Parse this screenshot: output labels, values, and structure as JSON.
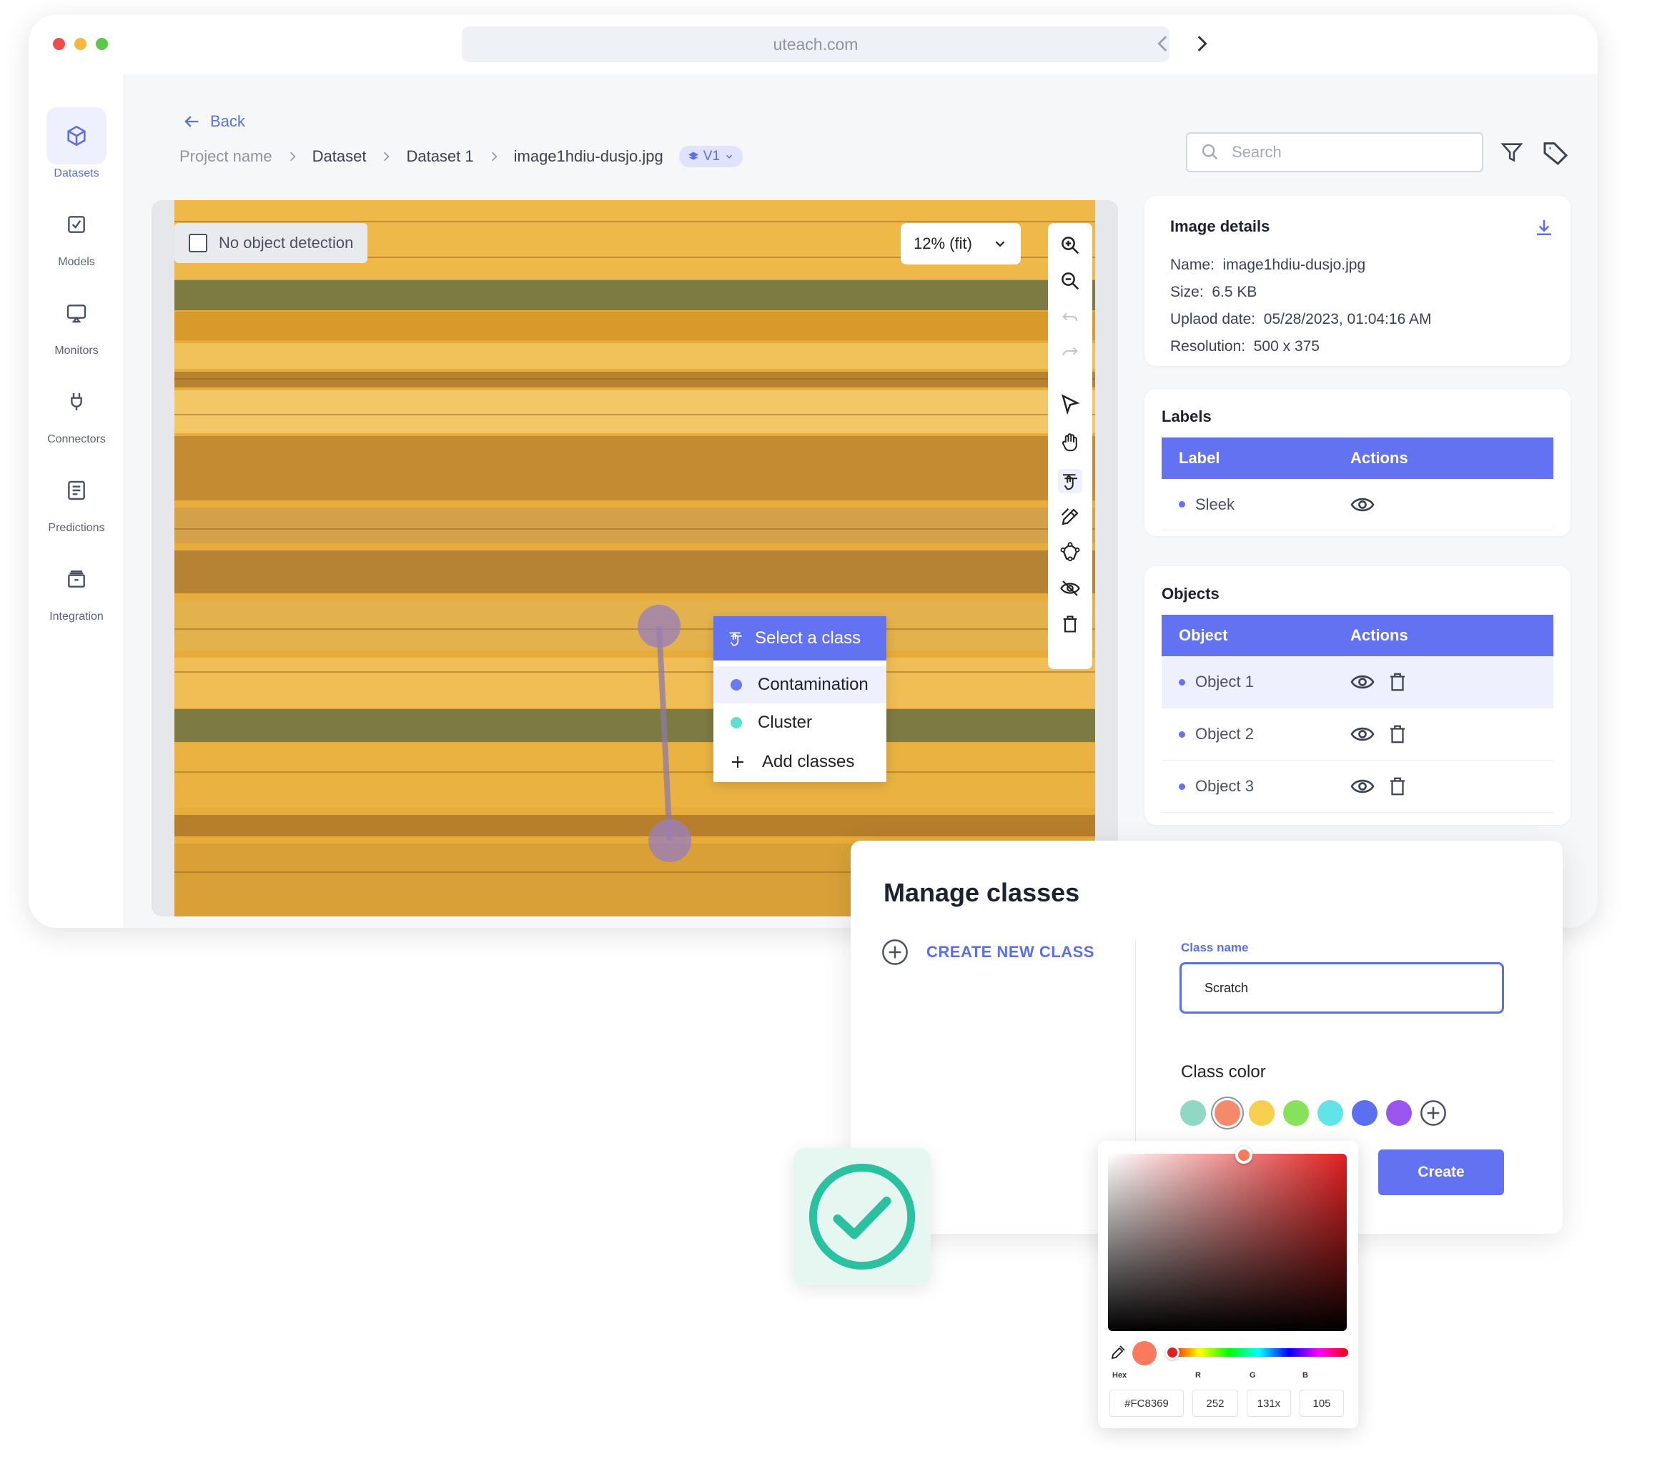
{
  "browser": {
    "url": "uteach.com"
  },
  "sidebar": {
    "items": [
      {
        "label": "Datasets",
        "icon": "cube-icon"
      },
      {
        "label": "Models",
        "icon": "chart-check-icon"
      },
      {
        "label": "Monitors",
        "icon": "monitor-icon"
      },
      {
        "label": "Connectors",
        "icon": "plug-icon"
      },
      {
        "label": "Predictions",
        "icon": "document-list-icon"
      },
      {
        "label": "Integration",
        "icon": "archive-icon"
      }
    ]
  },
  "nav": {
    "back_label": "Back"
  },
  "breadcrumb": {
    "items": [
      "Project name",
      "Dataset",
      "Dataset 1",
      "image1hdiu-dusjo.jpg"
    ],
    "version": "V1"
  },
  "search": {
    "placeholder": "Search"
  },
  "canvas": {
    "detection_label": "No object detection",
    "zoom": "12% (fit)"
  },
  "class_popup": {
    "title": "Select a class",
    "options": [
      {
        "label": "Contamination",
        "color": "#6a7af2"
      },
      {
        "label": "Cluster",
        "color": "#5ee0d0"
      }
    ],
    "add_label": "Add classes"
  },
  "image_details": {
    "title": "Image details",
    "fields": [
      {
        "key": "Name:",
        "value": "image1hdiu-dusjo.jpg"
      },
      {
        "key": "Size:",
        "value": "6.5 KB"
      },
      {
        "key": "Uplaod date:",
        "value": "05/28/2023, 01:04:16 AM"
      },
      {
        "key": "Resolution:",
        "value": "500 x 375"
      }
    ]
  },
  "labels": {
    "title": "Labels",
    "col_label": "Label",
    "col_actions": "Actions",
    "rows": [
      "Sleek"
    ]
  },
  "objects": {
    "title": "Objects",
    "col_object": "Object",
    "col_actions": "Actions",
    "rows": [
      "Object 1",
      "Object 2",
      "Object 3"
    ]
  },
  "manage": {
    "title": "Manage classes",
    "create_label": "CREATE NEW CLASS",
    "class_name_label": "Class name",
    "class_name_value": "Scratch",
    "class_color_label": "Class color",
    "create_button": "Create",
    "swatches": [
      "#8fd8c4",
      "#f58a6a",
      "#f6cf4e",
      "#86e25b",
      "#62e3e8",
      "#5b6ff0",
      "#9a55ef"
    ]
  },
  "picker": {
    "hex_label": "Hex",
    "r_label": "R",
    "g_label": "G",
    "b_label": "B",
    "hex": "#FC8369",
    "r": "252",
    "g": "131x",
    "b": "105",
    "color": "#fa7a60"
  },
  "colors": {
    "accent": "#6372f0"
  }
}
